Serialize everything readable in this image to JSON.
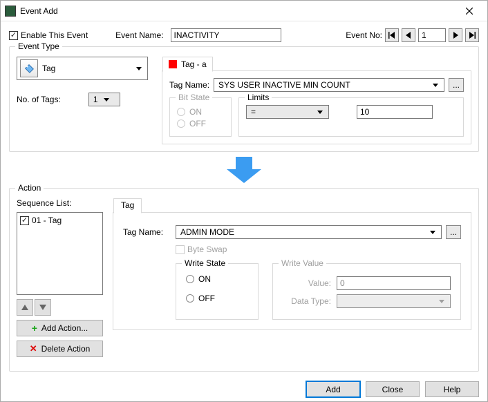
{
  "window": {
    "title": "Event Add"
  },
  "top": {
    "enable_label": "Enable This Event",
    "enable_checked": true,
    "event_name_label": "Event Name:",
    "event_name_value": "INACTIVITY",
    "event_no_label": "Event No:",
    "event_no_value": "1"
  },
  "event_type": {
    "legend": "Event Type",
    "dropdown_value": "Tag",
    "no_of_tags_label": "No. of Tags:",
    "no_of_tags_value": "1",
    "tab_label": "Tag - a",
    "tag_name_label": "Tag Name:",
    "tag_name_value": "SYS USER INACTIVE MIN COUNT",
    "bitstate": {
      "legend": "Bit State",
      "on": "ON",
      "off": "OFF"
    },
    "limits": {
      "legend": "Limits",
      "operator": "=",
      "value": "10"
    }
  },
  "action": {
    "legend": "Action",
    "seq_label": "Sequence List:",
    "seq_items": [
      "01 - Tag"
    ],
    "add_action_label": "Add Action...",
    "delete_action_label": "Delete Action",
    "tab_label": "Tag",
    "tag_name_label": "Tag Name:",
    "tag_name_value": "ADMIN MODE",
    "byte_swap_label": "Byte Swap",
    "write_state": {
      "legend": "Write State",
      "on": "ON",
      "off": "OFF",
      "selected": "OFF"
    },
    "write_value": {
      "legend": "Write Value",
      "value_label": "Value:",
      "value": "0",
      "datatype_label": "Data Type:",
      "datatype": ""
    }
  },
  "footer": {
    "add": "Add",
    "close": "Close",
    "help": "Help"
  }
}
